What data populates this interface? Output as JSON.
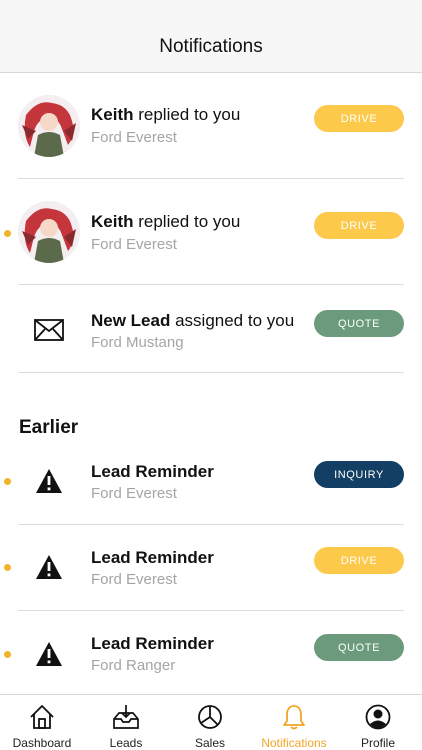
{
  "header": {
    "title": "Notifications"
  },
  "notifications_recent": [
    {
      "actor": "Keith",
      "action": " replied to you",
      "vehicle": "Ford Everest",
      "tag": "DRIVE",
      "unread": false,
      "icon": "avatar"
    },
    {
      "actor": "Keith",
      "action": " replied to you",
      "vehicle": "Ford Everest",
      "tag": "DRIVE",
      "unread": true,
      "icon": "avatar"
    },
    {
      "actor": "New Lead",
      "action": " assigned to you",
      "vehicle": "Ford Mustang",
      "tag": "QUOTE",
      "unread": false,
      "icon": "envelope-icon"
    }
  ],
  "earlier": {
    "title": "Earlier",
    "items": [
      {
        "actor": "Lead Reminder",
        "action": "",
        "vehicle": "Ford Everest",
        "tag": "INQUIRY",
        "unread": true,
        "icon": "warning-icon"
      },
      {
        "actor": "Lead Reminder",
        "action": "",
        "vehicle": "Ford Everest",
        "tag": "DRIVE",
        "unread": true,
        "icon": "warning-icon"
      },
      {
        "actor": "Lead Reminder",
        "action": "",
        "vehicle": "Ford Ranger",
        "tag": "QUOTE",
        "unread": true,
        "icon": "warning-icon"
      }
    ]
  },
  "tabbar": {
    "tabs": [
      {
        "label": "Dashboard",
        "icon": "home-icon",
        "active": false
      },
      {
        "label": "Leads",
        "icon": "inbox-download-icon",
        "active": false
      },
      {
        "label": "Sales",
        "icon": "pie-chart-icon",
        "active": false
      },
      {
        "label": "Notifications",
        "icon": "bell-icon",
        "active": true
      },
      {
        "label": "Profile",
        "icon": "user-circle-icon",
        "active": false
      }
    ]
  },
  "colors": {
    "drive": "#fcc94a",
    "quote": "#6b9b7c",
    "inquiry": "#123f63",
    "unread_dot": "#f2b32b",
    "active_tab": "#f0a623"
  }
}
